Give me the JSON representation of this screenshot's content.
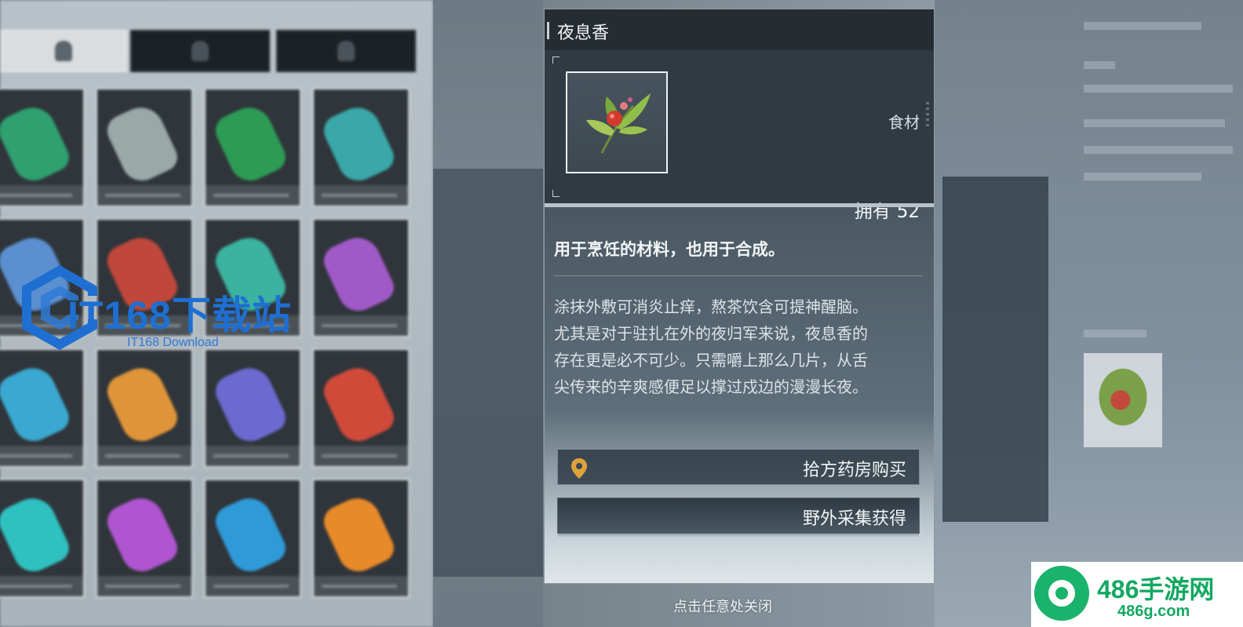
{
  "item": {
    "name": "夜息香",
    "type": "食材",
    "owned_label": "拥有",
    "owned_count": "52",
    "short_description": "用于烹饪的材料，也用于合成。",
    "long_description": "涂抹外敷可消炎止痒，熬茶饮含可提神醒脑。\n尤其是对于驻扎在外的夜归军来说，夜息香的\n存在更是必不可少。只需嚼上那么几片，从舌\n尖传来的辛爽感便足以撑过戍边的漫漫长夜。",
    "icon": "herb-berry-icon"
  },
  "sources": [
    {
      "label": "拾方药房购买",
      "icon": "location-pin-icon",
      "accent": "#e0a23a"
    },
    {
      "label": "野外采集获得"
    }
  ],
  "close_hint": "点击任意处关闭",
  "watermarks": {
    "left_title": "IT168下载站",
    "left_sub": "IT168 Download",
    "right_title": "486手游网",
    "right_url": "486g.com"
  },
  "colors": {
    "watermark_blue": "#1e6fd1",
    "watermark_green": "#13a862",
    "pin": "#e0a23a"
  }
}
